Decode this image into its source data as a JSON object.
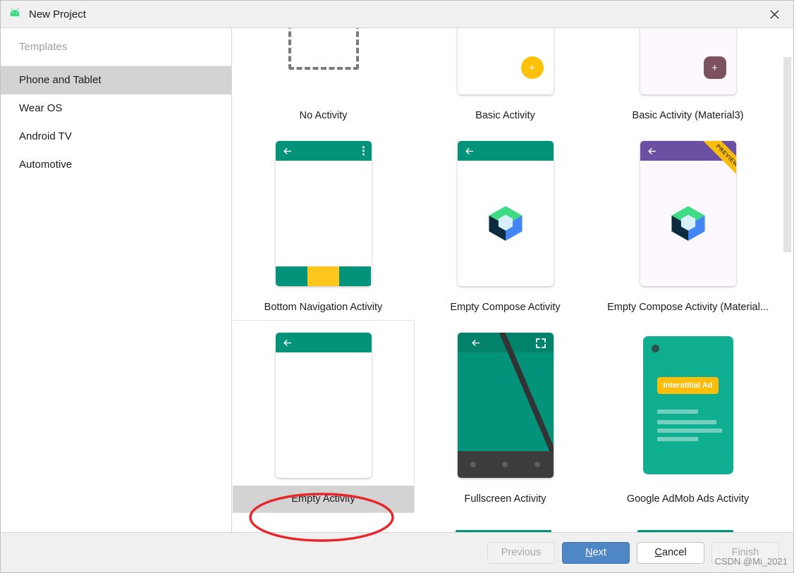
{
  "window": {
    "title": "New Project",
    "app_icon": "android-robot-icon",
    "close_icon": "close-icon"
  },
  "sidebar": {
    "group_label": "Templates",
    "items": [
      {
        "label": "Phone and Tablet",
        "selected": true
      },
      {
        "label": "Wear OS",
        "selected": false
      },
      {
        "label": "Android TV",
        "selected": false
      },
      {
        "label": "Automotive",
        "selected": false
      }
    ]
  },
  "templates": {
    "selected": "Empty Activity",
    "items": [
      {
        "label": "No Activity",
        "thumb": "dashed-placeholder"
      },
      {
        "label": "Basic Activity",
        "thumb": "fab-yellow"
      },
      {
        "label": "Basic Activity (Material3)",
        "thumb": "fab-material3"
      },
      {
        "label": "Bottom Navigation Activity",
        "thumb": "bottom-nav"
      },
      {
        "label": "Empty Compose Activity",
        "thumb": "compose-cube"
      },
      {
        "label": "Empty Compose Activity (Material...",
        "thumb": "compose-cube-material3-preview"
      },
      {
        "label": "Empty Activity",
        "thumb": "plain-appbar"
      },
      {
        "label": "Fullscreen Activity",
        "thumb": "fullscreen"
      },
      {
        "label": "Google AdMob Ads Activity",
        "thumb": "admob"
      }
    ],
    "preview_ribbon_label": "PREVIEW",
    "admob_badge_label": "Interstitial Ad",
    "fab_plus_label": "+"
  },
  "footer": {
    "previous_label": "Previous",
    "next_label_prefix": "",
    "next_label_accel": "N",
    "next_label_rest": "ext",
    "cancel_label_accel": "C",
    "cancel_label_rest": "ancel",
    "finish_label": "Finish"
  },
  "scrollbar": {
    "position_percent": 37
  },
  "watermark": "CSDN @Mi_2021",
  "colors": {
    "teal": "#03937a",
    "amber": "#ffc008",
    "material3_purple": "#7d5260",
    "compose_purple_bar": "#6a4fa3",
    "ribbon_yellow": "#fbbd0b",
    "primary_button": "#4f86c6",
    "selection_grey": "#d3d3d3",
    "annotation_red": "#e8252a",
    "admob_teal": "#0fae91"
  }
}
